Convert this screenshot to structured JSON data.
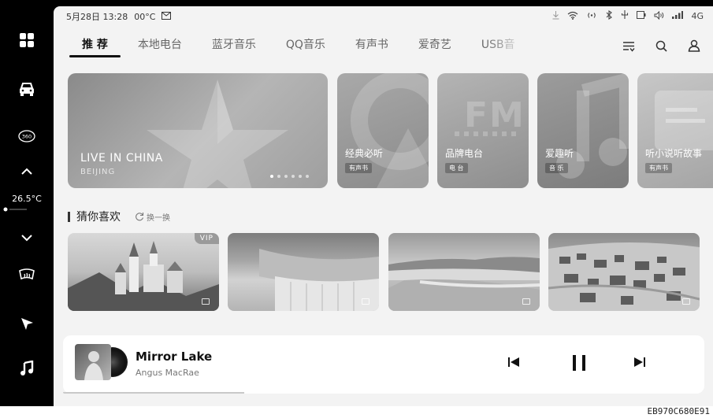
{
  "status": {
    "date_time": "5月28日 13:28",
    "temperature": "00°C",
    "network": "4G"
  },
  "sidebar": {
    "temperature": "26.5°C",
    "cam_label": "360"
  },
  "tabs": [
    {
      "label": "推 荐",
      "active": true
    },
    {
      "label": "本地电台"
    },
    {
      "label": "蓝牙音乐"
    },
    {
      "label": "QQ音乐"
    },
    {
      "label": "有声书"
    },
    {
      "label": "爱奇艺"
    },
    {
      "label": "USB音"
    }
  ],
  "hero": {
    "title": "LIVE IN CHINA",
    "subtitle": "BEIJING",
    "page_count": 6,
    "current_page": 1
  },
  "cards": [
    {
      "title": "经典必听",
      "tag": "有声书"
    },
    {
      "title": "品牌电台",
      "tag": "电 台",
      "art": "FM"
    },
    {
      "title": "爱趣听",
      "tag": "音 乐"
    },
    {
      "title": "听小说听故事",
      "tag": "有声书"
    }
  ],
  "recommend": {
    "title": "猜你喜欢",
    "refresh_label": "换一换",
    "vip_label": "VIP"
  },
  "player": {
    "title": "Mirror Lake",
    "artist": "Angus MacRae",
    "progress": 0.28
  },
  "image_code": "EB970C680E91"
}
